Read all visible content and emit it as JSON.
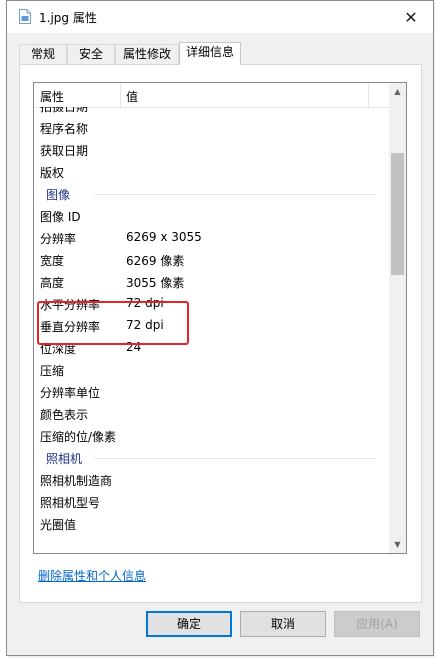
{
  "window": {
    "title": "1.jpg 属性",
    "close_glyph": "✕"
  },
  "tabs": [
    {
      "label": "常规"
    },
    {
      "label": "安全"
    },
    {
      "label": "属性修改"
    },
    {
      "label": "详细信息"
    }
  ],
  "list": {
    "header_property": "属性",
    "header_value": "值",
    "rows": [
      {
        "type": "item",
        "name": "拍摄日期",
        "value": ""
      },
      {
        "type": "item",
        "name": "程序名称",
        "value": ""
      },
      {
        "type": "item",
        "name": "获取日期",
        "value": ""
      },
      {
        "type": "item",
        "name": "版权",
        "value": ""
      },
      {
        "type": "group",
        "name": "图像",
        "value": ""
      },
      {
        "type": "item",
        "name": "图像 ID",
        "value": ""
      },
      {
        "type": "item",
        "name": "分辨率",
        "value": "6269 x 3055"
      },
      {
        "type": "item",
        "name": "宽度",
        "value": "6269 像素"
      },
      {
        "type": "item",
        "name": "高度",
        "value": "3055 像素"
      },
      {
        "type": "item",
        "name": "水平分辨率",
        "value": "72 dpi"
      },
      {
        "type": "item",
        "name": "垂直分辨率",
        "value": "72 dpi"
      },
      {
        "type": "item",
        "name": "位深度",
        "value": "24"
      },
      {
        "type": "item",
        "name": "压缩",
        "value": ""
      },
      {
        "type": "item",
        "name": "分辨率单位",
        "value": ""
      },
      {
        "type": "item",
        "name": "颜色表示",
        "value": ""
      },
      {
        "type": "item",
        "name": "压缩的位/像素",
        "value": ""
      },
      {
        "type": "group",
        "name": "照相机",
        "value": ""
      },
      {
        "type": "item",
        "name": "照相机制造商",
        "value": ""
      },
      {
        "type": "item",
        "name": "照相机型号",
        "value": ""
      },
      {
        "type": "item",
        "name": "光圈值",
        "value": ""
      }
    ]
  },
  "link_remove": "删除属性和个人信息",
  "buttons": {
    "ok": "确定",
    "cancel": "取消",
    "apply": "应用(A)"
  },
  "colors": {
    "highlight": "#e3242b",
    "link": "#0066cc",
    "group": "#1e3287"
  }
}
